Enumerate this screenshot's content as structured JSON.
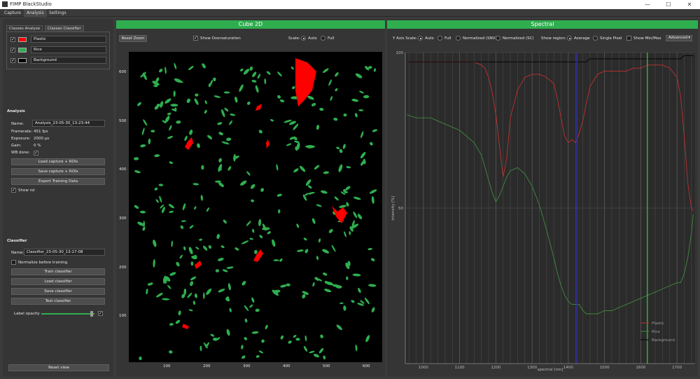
{
  "window": {
    "title": "FIMP BlackStudio",
    "minimize": "—",
    "maximize": "☐",
    "close": "✕"
  },
  "menu": {
    "tabs": [
      {
        "label": "Capture"
      },
      {
        "label": "Analysis"
      },
      {
        "label": "Settings"
      }
    ]
  },
  "left": {
    "subtabs": [
      {
        "label": "Classes Analyse"
      },
      {
        "label": "Classes Classifier"
      }
    ],
    "classes": [
      {
        "name": "Plastic",
        "color": "#ff0000",
        "checked": "✓"
      },
      {
        "name": "Rice",
        "color": "#2fae4f",
        "checked": "✓"
      },
      {
        "name": "Background",
        "color": "#000000",
        "checked": "✓"
      }
    ],
    "analysis": {
      "heading": "Analysis",
      "name_label": "Name:",
      "name_value": "Analysis_23-05-30_13-23-44",
      "framerate_label": "Framerate:",
      "framerate_value": "451 fps",
      "exposure_label": "Exposure:",
      "exposure_value": "2000 µs",
      "gain_label": "Gain:",
      "gain_value": "0 %",
      "wb_label": "WB done:",
      "wb_value": "✓",
      "load_btn": "Load capture + ROIs",
      "save_btn": "Save capture + ROIs",
      "export_btn": "Export Training Data",
      "show_roi": "Show roi",
      "show_roi_checked": "✓"
    },
    "classifier": {
      "heading": "Classifier",
      "name_label": "Name:",
      "name_value": "Classifier_23-05-30_13-17-08",
      "normalize": "Normalize before training",
      "train_btn": "Train classifier",
      "load_btn": "Load classifier",
      "save_btn": "Save classifier",
      "test_btn": "Test classifier",
      "opacity_label": "Label opacity",
      "opacity_checked": "✓",
      "opacity_value": 0.97
    },
    "reset_view": "Reset view"
  },
  "cube": {
    "header": "Cube 2D",
    "reset_zoom": "Reset Zoom",
    "show_oversat": "Show Oversaturation",
    "show_oversat_checked": "✓",
    "scale_label": "Scale:",
    "scale_auto": "Auto",
    "scale_full": "Full",
    "y_ticks": [
      "600",
      "500",
      "400",
      "300",
      "200",
      "100"
    ],
    "x_ticks": [
      "100",
      "200",
      "300",
      "400",
      "500",
      "600"
    ]
  },
  "spectral": {
    "header": "Spectral",
    "y_axis_scale_label": "Y Axis Scale:",
    "opt_auto": "Auto",
    "opt_full": "Full",
    "opt_norm_snv": "Normalized (SNV)",
    "opt_norm_sc": "Normalized (SC)",
    "show_region_label": "Show region:",
    "opt_average": "Average",
    "opt_single_pixel": "Single Pixel",
    "show_minmax": "Show Min/Max",
    "advanced": "Advanced",
    "advanced_arrow": "▾"
  },
  "chart_data": {
    "type": "line",
    "title": "",
    "xlabel": "spectral [nm]",
    "ylabel": "intensity [%]",
    "xlim": [
      950,
      1750
    ],
    "ylim": [
      0,
      100
    ],
    "x_ticks": [
      "1000",
      "1100",
      "1200",
      "1300",
      "1400",
      "1500",
      "1600",
      "1700"
    ],
    "y_ticks": [
      "100",
      "50"
    ],
    "legend_position": "bottom-right",
    "colors": {
      "plastic": "#c03030",
      "rice": "#3f8a3f",
      "background": "#000000",
      "blue_marker": "#2828d0",
      "green_marker": "#30c030"
    },
    "markers": [
      1424,
      1618
    ],
    "x": [
      955,
      980,
      1000,
      1020,
      1040,
      1060,
      1080,
      1100,
      1120,
      1140,
      1160,
      1170,
      1180,
      1190,
      1200,
      1210,
      1220,
      1230,
      1240,
      1260,
      1280,
      1300,
      1320,
      1340,
      1360,
      1370,
      1380,
      1390,
      1400,
      1410,
      1420,
      1430,
      1440,
      1450,
      1460,
      1480,
      1500,
      1520,
      1540,
      1560,
      1580,
      1600,
      1620,
      1640,
      1660,
      1680,
      1700,
      1710,
      1720,
      1730,
      1740,
      1745
    ],
    "series": [
      {
        "name": "Plastic",
        "color": "#c03030",
        "values": [
          97,
          97,
          97,
          97,
          97,
          97,
          97,
          97,
          97,
          97,
          96,
          95,
          92,
          87,
          80,
          70,
          60,
          66,
          79,
          88,
          92,
          93,
          93,
          92,
          90,
          85,
          79,
          73,
          71,
          72,
          71,
          74,
          78,
          84,
          89,
          93,
          94,
          94,
          94,
          94,
          95,
          95,
          96,
          96,
          96,
          95,
          92,
          86,
          73,
          58,
          50,
          49
        ]
      },
      {
        "name": "Rice",
        "color": "#3f8a3f",
        "values": [
          80,
          79,
          79,
          79,
          78,
          77,
          76,
          75,
          73,
          71,
          67,
          63,
          59,
          55,
          52,
          54,
          57,
          60,
          62,
          63,
          61,
          57,
          51,
          43,
          34,
          29,
          25,
          22,
          20,
          19,
          19,
          19,
          17,
          16,
          16,
          16,
          17,
          17,
          18,
          19,
          20,
          21,
          22,
          23,
          24,
          25,
          26,
          26,
          29,
          34,
          42,
          48
        ]
      },
      {
        "name": "Background",
        "color": "#000000",
        "values": [
          97,
          97,
          97,
          97,
          97,
          97,
          97,
          97,
          97,
          97,
          97,
          97,
          97,
          97,
          97,
          97,
          97,
          97,
          97,
          97,
          97,
          97,
          97,
          97,
          97,
          97,
          97,
          97,
          97,
          97,
          97,
          97,
          97,
          97,
          98,
          98,
          98,
          98,
          98,
          98,
          98,
          98,
          98,
          98,
          98,
          98,
          98,
          98,
          99,
          99,
          99,
          99
        ]
      }
    ]
  }
}
